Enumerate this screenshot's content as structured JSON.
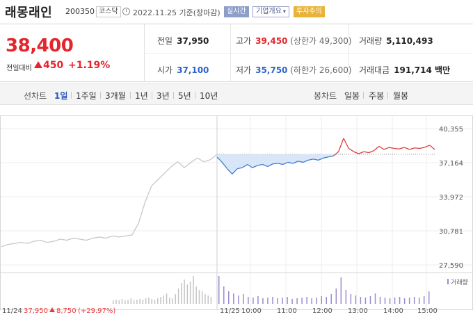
{
  "header": {
    "stock_name": "래몽래인",
    "stock_code": "200350",
    "market_badge": "코스닥",
    "date_text": "2022.11.25 기준(장마감)",
    "realtime_label": "실시간",
    "corp_overview_label": "기업개요",
    "warning_badge": "투자주의"
  },
  "summary": {
    "price": "38,400",
    "change_label": "전일대비",
    "change_value": "450",
    "change_percent": "+1.19%",
    "prev_close_label": "전일",
    "prev_close": "37,950",
    "open_label": "시가",
    "open": "37,100",
    "high_label": "고가",
    "high": "39,450",
    "upper_limit": "(상한가 49,300)",
    "low_label": "저가",
    "low": "35,750",
    "lower_limit": "(하한가 26,600)",
    "volume_label": "거래량",
    "volume": "5,110,493",
    "trade_value_label": "거래대금",
    "trade_value": "191,714 백만"
  },
  "tabs": {
    "line_chart_label": "선차트",
    "periods": [
      "1일",
      "1주일",
      "3개월",
      "1년",
      "3년",
      "5년",
      "10년"
    ],
    "active_period": "1일",
    "candle_chart_label": "봉차트",
    "candle_periods": [
      "일봉",
      "주봉",
      "월봉"
    ]
  },
  "chart_data": {
    "type": "line",
    "y_ticks": [
      "40,355",
      "37,164",
      "33,972",
      "30,781",
      "27,590"
    ],
    "ylim": [
      27590,
      40355
    ],
    "reference_price": 37950,
    "volume_legend": "거래량",
    "x_ticks": [
      "11/24",
      "11/25",
      "10:00",
      "11:00",
      "12:00",
      "13:00",
      "14:00",
      "15:00"
    ],
    "footer_prev_day": "11/24",
    "footer_prev_close": "37,950",
    "footer_prev_change": "8,750",
    "footer_prev_pct": "(+29.97%)",
    "colors": {
      "up": "#e23b3b",
      "down": "#3f7bd4",
      "prev_day": "#c8c8c8",
      "fill_down": "#d8e6f8",
      "volume_today": "#9b8ad0",
      "volume_prev": "#c4c4c4"
    },
    "prev_day_series": [
      29300,
      29500,
      29600,
      29700,
      29600,
      29800,
      29900,
      29700,
      29800,
      30000,
      29900,
      30100,
      30000,
      29900,
      30100,
      30200,
      30100,
      30300,
      30200,
      30300,
      30400,
      31500,
      33500,
      35000,
      35600,
      36200,
      36800,
      37250,
      36700,
      37200,
      37600,
      37250,
      37450,
      37950
    ],
    "today_series": [
      37700,
      37200,
      36600,
      36100,
      36600,
      36700,
      37000,
      36700,
      36900,
      37000,
      36800,
      37050,
      37100,
      37000,
      37200,
      37100,
      37300,
      37200,
      37400,
      37500,
      37400,
      37600,
      37700,
      37800,
      38200,
      39450,
      38500,
      38200,
      38000,
      38200,
      38100,
      38300,
      38700,
      38400,
      38600,
      38500,
      38450,
      38600,
      38400,
      38550,
      38500,
      38600,
      38800,
      38400
    ],
    "prev_volume": [
      5,
      6,
      5,
      7,
      5,
      6,
      8,
      5,
      6,
      7,
      6,
      8,
      9,
      7,
      6,
      8,
      10,
      12,
      15,
      9,
      8,
      14,
      22,
      30,
      35,
      28,
      32,
      40,
      25,
      20,
      18,
      14,
      12,
      10
    ],
    "today_volume": [
      40,
      25,
      18,
      15,
      12,
      14,
      10,
      9,
      11,
      8,
      9,
      10,
      8,
      9,
      10,
      7,
      8,
      9,
      10,
      8,
      9,
      11,
      10,
      14,
      22,
      38,
      20,
      14,
      12,
      10,
      9,
      11,
      15,
      10,
      9,
      8,
      9,
      10,
      8,
      9,
      10,
      9,
      11,
      18
    ]
  }
}
